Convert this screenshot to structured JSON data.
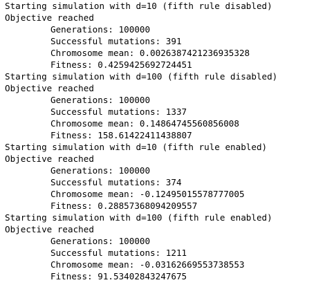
{
  "runs": [
    {
      "header": "Starting simulation with d=10 (fifth rule disabled)",
      "status": "Objective reached",
      "generations": "Generations: 100000",
      "successful_mutations": "Successful mutations: 391",
      "chromosome_mean": "Chromosome mean: 0.0026387421236935328",
      "fitness": "Fitness: 0.4259425692724451"
    },
    {
      "header": "Starting simulation with d=100 (fifth rule disabled)",
      "status": "Objective reached",
      "generations": "Generations: 100000",
      "successful_mutations": "Successful mutations: 1337",
      "chromosome_mean": "Chromosome mean: 0.14864745560856008",
      "fitness": "Fitness: 158.61422411438807"
    },
    {
      "header": "Starting simulation with d=10 (fifth rule enabled)",
      "status": "Objective reached",
      "generations": "Generations: 100000",
      "successful_mutations": "Successful mutations: 374",
      "chromosome_mean": "Chromosome mean: -0.12495015578777005",
      "fitness": "Fitness: 0.28857368094209557"
    },
    {
      "header": "Starting simulation with d=100 (fifth rule enabled)",
      "status": "Objective reached",
      "generations": "Generations: 100000",
      "successful_mutations": "Successful mutations: 1211",
      "chromosome_mean": "Chromosome mean: -0.03162669553738553",
      "fitness": "Fitness: 91.53402843247675"
    }
  ]
}
